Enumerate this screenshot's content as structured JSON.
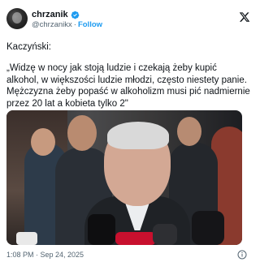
{
  "author": {
    "display_name": "chrzanik",
    "handle": "@chrzanikx",
    "separator": "·",
    "follow_label": "Follow",
    "verified": true,
    "verified_color": "#1d9bf0"
  },
  "platform_icon": "x-logo-icon",
  "tweet": {
    "line1": "Kaczyński:",
    "line2": "„Widzę w nocy jak stoją ludzie i czekają żeby kupić alkohol, w większości ludzie młodzi, często niestety panie. Mężczyzna żeby popaść w alkoholizm musi pić nadmiernie przez 20 lat a kobieta tylko 2\""
  },
  "media": {
    "type": "photo"
  },
  "footer": {
    "timestamp": "1:08 PM · Sep 24, 2025",
    "info_icon": "info-icon"
  },
  "colors": {
    "accent": "#1d9bf0",
    "text": "#0f1419",
    "secondary": "#536471"
  }
}
